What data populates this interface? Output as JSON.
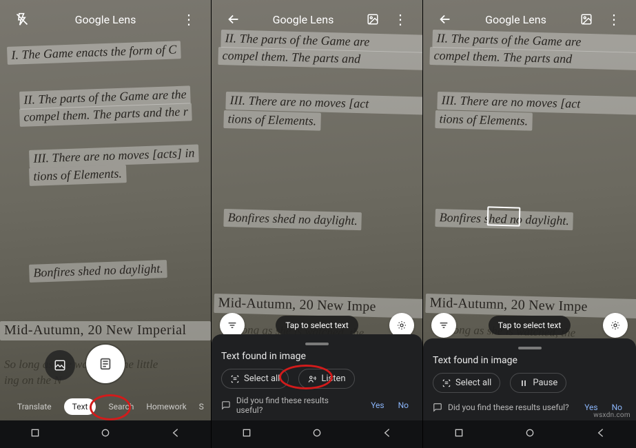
{
  "app_title": "Google Lens",
  "watermark": "wsxdn.com",
  "book_text": {
    "line_game": "I. The Game enacts the form of C",
    "line_parts_a": "II. The parts of the Game are the",
    "line_parts_b": "compel them. The parts and the r",
    "line_parts_a2": "II. The parts of the Game are",
    "line_parts_b2": "compel them. The parts and",
    "line_moves_a": "III. There are no moves [acts] in",
    "line_moves_b": "tions of Elements.",
    "line_moves_a2": "III. There are no moves [act",
    "bonfires": "Bonfires shed no daylight.",
    "midautumn_1": "Mid-Autumn, 20 New Imperial",
    "midautumn_23": "Mid-Autumn, 20 New Impe",
    "solong_a": "So long as she watched, the little",
    "solong_b": "ing on the N",
    "solong_23": "So long as she is watched, the"
  },
  "modes": {
    "translate": "Translate",
    "text": "Text",
    "search": "Search",
    "homework": "Homework",
    "shopping": "S"
  },
  "panel": {
    "tap_hint": "Tap to select text",
    "title": "Text found in image",
    "select_all": "Select all",
    "listen": "Listen",
    "pause": "Pause",
    "feedback_q": "Did you find these results useful?",
    "yes": "Yes",
    "no": "No"
  },
  "highlighted_word": "shed"
}
